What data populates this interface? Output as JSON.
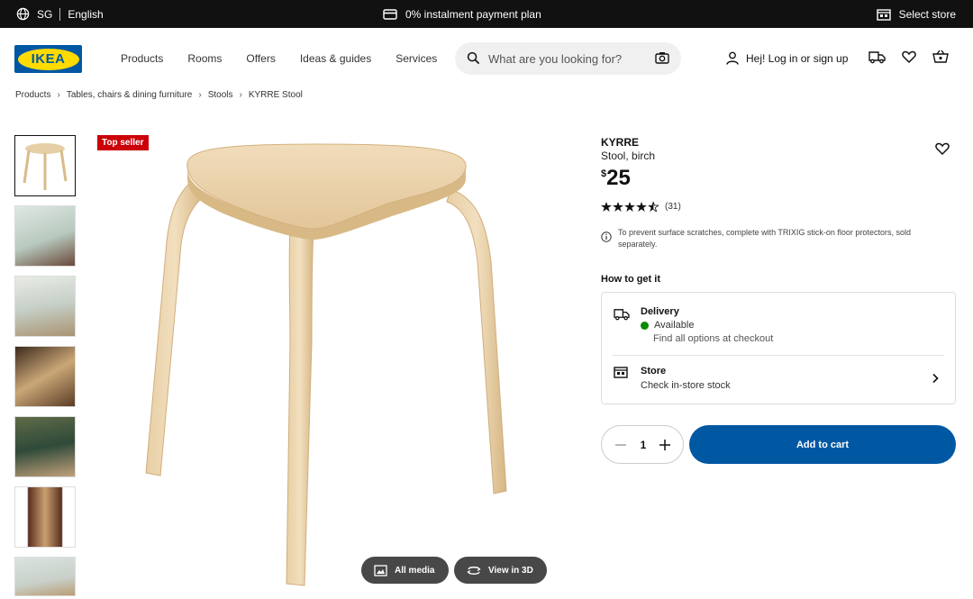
{
  "topbar": {
    "country": "SG",
    "language": "English",
    "promo": "0% instalment payment plan",
    "store": "Select store"
  },
  "header": {
    "logo": "IKEA",
    "nav": [
      "Products",
      "Rooms",
      "Offers",
      "Ideas & guides",
      "Services"
    ],
    "search_placeholder": "What are you looking for?",
    "account": "Hej! Log in or sign up"
  },
  "breadcrumb": [
    "Products",
    "Tables, chairs & dining furniture",
    "Stools",
    "KYRRE Stool"
  ],
  "gallery": {
    "badge": "Top seller",
    "all_media": "All media",
    "view_3d": "View in 3D"
  },
  "product": {
    "name": "KYRRE",
    "description": "Stool, birch",
    "currency": "$",
    "price": "25",
    "rating": 4.5,
    "reviews": "(31)",
    "info": "To prevent surface scratches, complete with TRIXIG stick-on floor protectors, sold separately."
  },
  "fulfilment": {
    "heading": "How to get it",
    "delivery_title": "Delivery",
    "delivery_status": "Available",
    "delivery_sub": "Find all options at checkout",
    "store_title": "Store",
    "store_sub": "Check in-store stock"
  },
  "cart": {
    "quantity": "1",
    "add_label": "Add to cart"
  },
  "colors": {
    "brand_blue": "#0058a3",
    "brand_yellow": "#ffdb00",
    "badge_red": "#cc0008",
    "available_green": "#0a8a00"
  }
}
